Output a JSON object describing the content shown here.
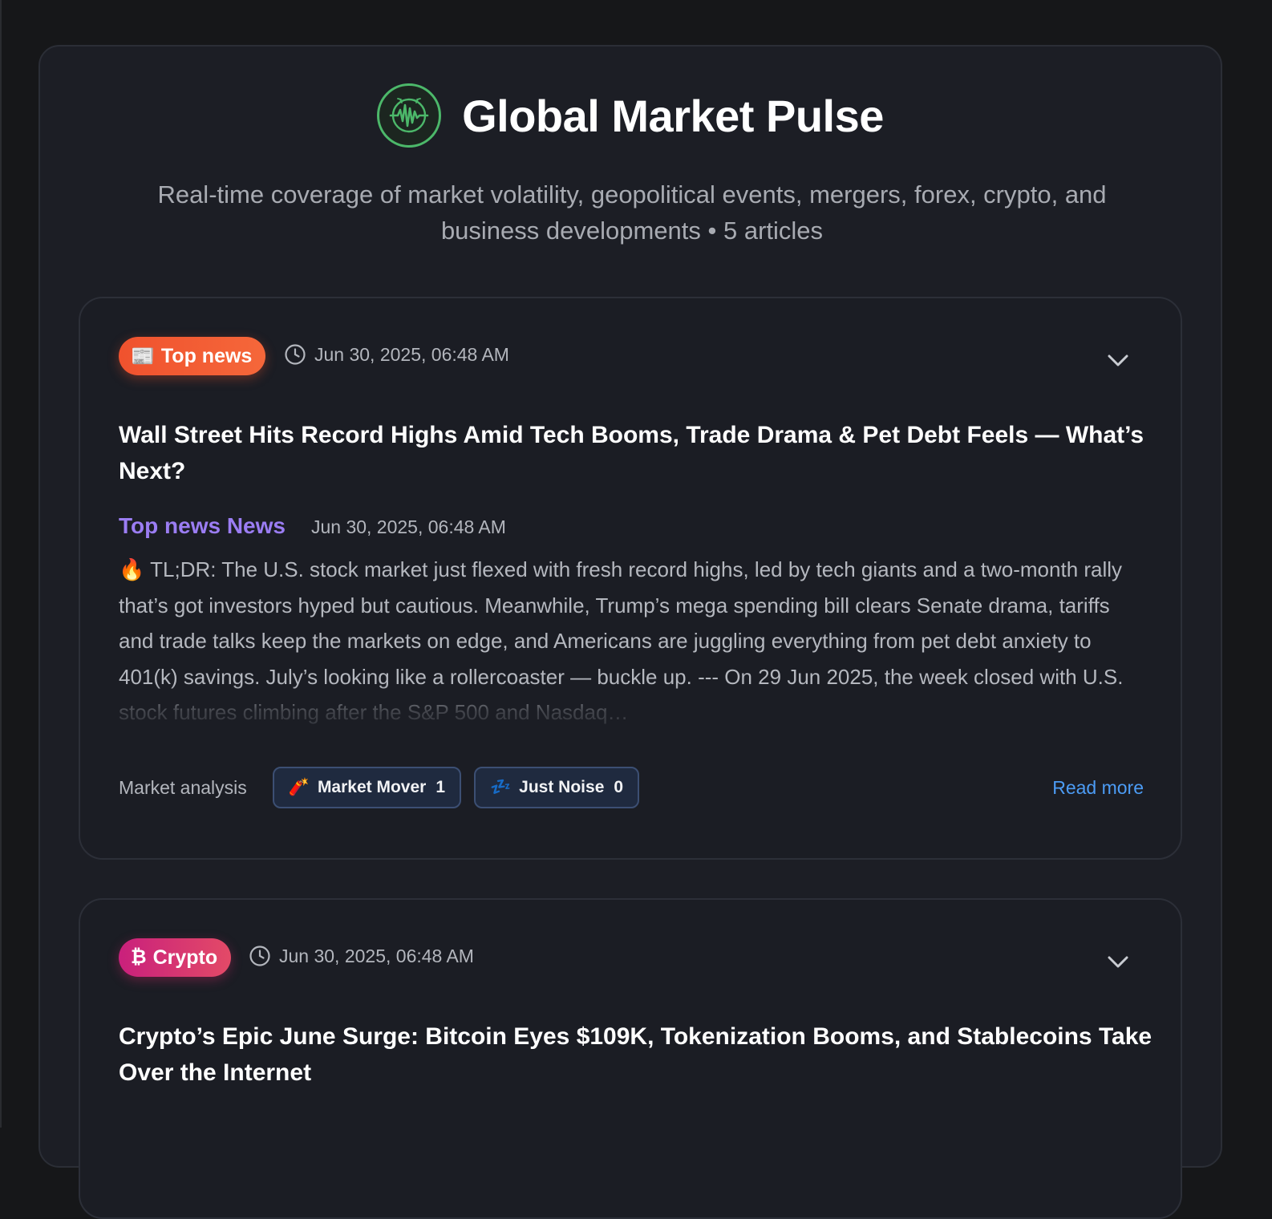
{
  "header": {
    "title": "Global Market Pulse",
    "subtitle": "Real-time coverage of market volatility, geopolitical events, mergers, forex, crypto, and business developments • 5 articles"
  },
  "colors": {
    "background": "#161719",
    "panel": "#1c1e25",
    "logo_green": "#4cb86a",
    "source_purple": "#9b7df3",
    "link_blue": "#4c9cf5",
    "top_news_orange": "#f0522e",
    "crypto_pink": "#c9207c"
  },
  "articles": [
    {
      "category": "Top news",
      "category_icon": "newspaper-emoji",
      "category_emoji": "📰",
      "timestamp": "Jun 30, 2025, 06:48 AM",
      "headline": "Wall Street Hits Record Highs Amid Tech Booms, Trade Drama & Pet Debt Feels — What’s Next?",
      "source": "Top news News",
      "source_date": "Jun 30, 2025, 06:48 AM",
      "body": "🔥 TL;DR: The U.S. stock market just flexed with fresh record highs, led by tech giants and a two-month rally that’s got investors hyped but cautious. Meanwhile, Trump’s mega spending bill clears Senate drama, tariffs and trade talks keep the markets on edge, and Americans are juggling everything from pet debt anxiety to 401(k) savings. July’s looking like a rollercoaster — buckle up. --- On 29 Jun 2025, the week closed with U.S. stock futures climbing after the S&P 500 and Nasdaq…",
      "analysis_label": "Market analysis",
      "market_mover": {
        "icon": "firecracker-emoji",
        "emoji": "🧨",
        "label": "Market Mover",
        "count": "1"
      },
      "just_noise": {
        "icon": "sleeping-zzz-emoji",
        "emoji": "💤",
        "label": "Just Noise",
        "count": "0"
      },
      "read_more": "Read more"
    },
    {
      "category": "Crypto",
      "category_icon": "bitcoin-icon",
      "category_emoji": "₿",
      "timestamp": "Jun 30, 2025, 06:48 AM",
      "headline": "Crypto’s Epic June Surge: Bitcoin Eyes $109K, Tokenization Booms, and Stablecoins Take Over the Internet"
    }
  ]
}
